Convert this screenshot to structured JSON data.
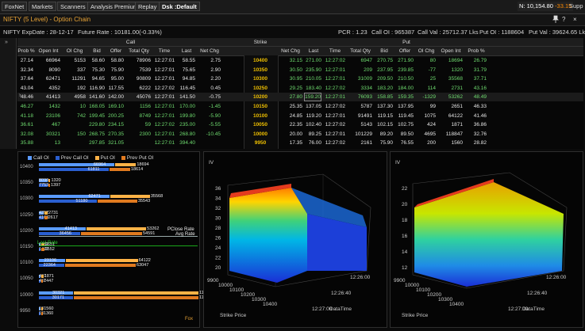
{
  "toolbar": {
    "buttons": [
      "FoxNet",
      "Markets",
      "Scanners",
      "Analysis Premium",
      "Replay",
      "Dsk :Default"
    ],
    "index_label": "N: 10,154.80",
    "index_change": "-33.15",
    "support_label": "Supp"
  },
  "window": {
    "title": "NIFTY (5 Level) - Option Chain",
    "pin_icon": "pin-icon",
    "help_label": "?",
    "close_label": "×"
  },
  "info": {
    "symbol_expiry": "NIFTY ExpDate : 28-12-17",
    "future_rate": "Future Rate : 10181.00(-0.33%)",
    "pcr": "PCR : 1.23",
    "call_oi": "Call OI : 965387",
    "call_val": "Call Val : 25712.37 Lks",
    "put_oi": "Put OI : 1188604",
    "put_val": "Put Val : 39624.65 Lks"
  },
  "grid": {
    "group_call": "Call",
    "group_strike": "Strike",
    "group_put": "Put",
    "call_headers": [
      "Prob %",
      "Open Int",
      "OI Chg",
      "Bid",
      "Offer",
      "Total Qty",
      "Time",
      "Last",
      "Net Chg"
    ],
    "put_headers": [
      "Net Chg",
      "Last",
      "Time",
      "Total Qty",
      "Bid",
      "Offer",
      "OI Chg",
      "Open Int",
      "Prob %"
    ],
    "rows": [
      {
        "call": [
          "27.14",
          "66964",
          "5153",
          "58.60",
          "58.80",
          "78906",
          "12:27:01",
          "58.55",
          "2.75"
        ],
        "strike": "10400",
        "put": [
          "32.15",
          "271.00",
          "12:27:02",
          "6947",
          "270.75",
          "271.90",
          "80",
          "18694",
          "26.79"
        ]
      },
      {
        "call": [
          "32.34",
          "8090",
          "337",
          "75.30",
          "75.90",
          "7539",
          "12:27:01",
          "75.65",
          "2.90"
        ],
        "strike": "10350",
        "put": [
          "30.50",
          "235.90",
          "12:27:01",
          "209",
          "237.95",
          "239.85",
          "-77",
          "1320",
          "31.79"
        ]
      },
      {
        "call": [
          "37.64",
          "62471",
          "11291",
          "94.65",
          "95.00",
          "90809",
          "12:27:01",
          "94.85",
          "2.20"
        ],
        "strike": "10300",
        "put": [
          "30.95",
          "210.05",
          "12:27:01",
          "31009",
          "209.50",
          "210.50",
          "25",
          "35568",
          "37.71"
        ]
      },
      {
        "call": [
          "43.04",
          "4352",
          "192",
          "116.90",
          "117.55",
          "6222",
          "12:27:02",
          "116.45",
          "0.45"
        ],
        "strike": "10250",
        "put": [
          "29.25",
          "183.40",
          "12:27:02",
          "3334",
          "183.20",
          "184.00",
          "114",
          "2731",
          "43.16"
        ]
      },
      {
        "call": [
          "48.46",
          "41413",
          "4958",
          "141.60",
          "142.00",
          "45076",
          "12:27:01",
          "141.50",
          "-0.75"
        ],
        "strike": "10200",
        "put": [
          "27.80",
          "159.20",
          "12:27:01",
          "76093",
          "158.85",
          "159.35",
          "-1329",
          "53262",
          "48.49"
        ]
      },
      {
        "call": [
          "46.27",
          "1432",
          "10",
          "168.05",
          "169.10",
          "1156",
          "12:27:01",
          "170.00",
          "-1.45"
        ],
        "strike": "10150",
        "put": [
          "25.35",
          "137.05",
          "12:27:02",
          "5787",
          "137.30",
          "137.95",
          "99",
          "2651",
          "46.33"
        ]
      },
      {
        "call": [
          "41.18",
          "23106",
          "742",
          "199.45",
          "200.25",
          "8749",
          "12:27:01",
          "199.80",
          "-5.90"
        ],
        "strike": "10100",
        "put": [
          "24.85",
          "119.20",
          "12:27:01",
          "91491",
          "119.15",
          "119.45",
          "1075",
          "64122",
          "41.46"
        ]
      },
      {
        "call": [
          "36.61",
          "467",
          "",
          "229.80",
          "234.15",
          "59",
          "12:27:02",
          "235.00",
          "-5.55"
        ],
        "strike": "10050",
        "put": [
          "22.35",
          "102.40",
          "12:27:02",
          "5143",
          "102.15",
          "102.75",
          "424",
          "1871",
          "36.86"
        ]
      },
      {
        "call": [
          "32.08",
          "30321",
          "150",
          "268.75",
          "270.35",
          "2300",
          "12:27:01",
          "268.80",
          "-10.45"
        ],
        "strike": "10000",
        "put": [
          "20.00",
          "89.25",
          "12:27:01",
          "101229",
          "89.20",
          "89.50",
          "4695",
          "118847",
          "32.76"
        ]
      },
      {
        "call": [
          "35.88",
          "13",
          "",
          "297.85",
          "321.05",
          "",
          "12:27:01",
          "394.40",
          ""
        ],
        "strike": "9950",
        "put": [
          "17.35",
          "76.00",
          "12:27:02",
          "2161",
          "75.90",
          "76.55",
          "200",
          "1560",
          "28.82"
        ]
      }
    ]
  },
  "oi_chart": {
    "legend": [
      "Call OI",
      "Prev Call OI",
      "Put OI",
      "Prev Put OI"
    ],
    "strikes": [
      "10400",
      "10350",
      "10300",
      "10250",
      "10200",
      "10150",
      "10100",
      "10050",
      "10000",
      "9950"
    ],
    "bars": [
      {
        "call": 66964,
        "prev_call": 61811,
        "put": 18694,
        "prev_put": 18614
      },
      {
        "call": 8090,
        "prev_call": 7753,
        "put": 1320,
        "prev_put": 1397
      },
      {
        "call": 62471,
        "prev_call": 51180,
        "put": 35568,
        "prev_put": 35543
      },
      {
        "call": 4352,
        "prev_call": 4160,
        "put": 2731,
        "prev_put": 2617
      },
      {
        "call": 41413,
        "prev_call": 36456,
        "put": 53262,
        "prev_put": 54591
      },
      {
        "call": 1432,
        "prev_call": 1422,
        "put": 2651,
        "prev_put": 2552
      },
      {
        "call": 23106,
        "prev_call": 22364,
        "put": 64122,
        "prev_put": 63047
      },
      {
        "call": 467,
        "prev_call": 467,
        "put": 1871,
        "prev_put": 1447
      },
      {
        "call": 30321,
        "prev_call": 30171,
        "put": 118847,
        "prev_put": 114152
      },
      {
        "call": 13,
        "prev_call": 13,
        "put": 1560,
        "prev_put": 1360
      }
    ],
    "pclose_label": "PClose Rate",
    "avg_label": "Avg Rate",
    "last_rate_label": "Last Rate",
    "watermark": "Fox"
  },
  "surface_call": {
    "z_ticks": [
      "36",
      "34",
      "32",
      "30",
      "28",
      "26",
      "24",
      "22",
      "20"
    ],
    "strike_ticks": [
      "9900",
      "10000",
      "10100",
      "10200",
      "10300",
      "10400"
    ],
    "time_ticks": [
      "12:26:00",
      "12:26:40",
      "12:27:00"
    ],
    "xlabel": "Strike Price",
    "ylabel": "DataTime",
    "zlabel": "IV"
  },
  "surface_put": {
    "z_ticks": [
      "22",
      "20",
      "18",
      "16",
      "14",
      "12"
    ],
    "strike_ticks": [
      "9900",
      "10000",
      "10100",
      "10200",
      "10300",
      "10400"
    ],
    "time_ticks": [
      "12:26:00",
      "12:26:40",
      "12:27:00"
    ],
    "xlabel": "Strike Price",
    "ylabel": "DataTime",
    "zlabel": "IV"
  }
}
